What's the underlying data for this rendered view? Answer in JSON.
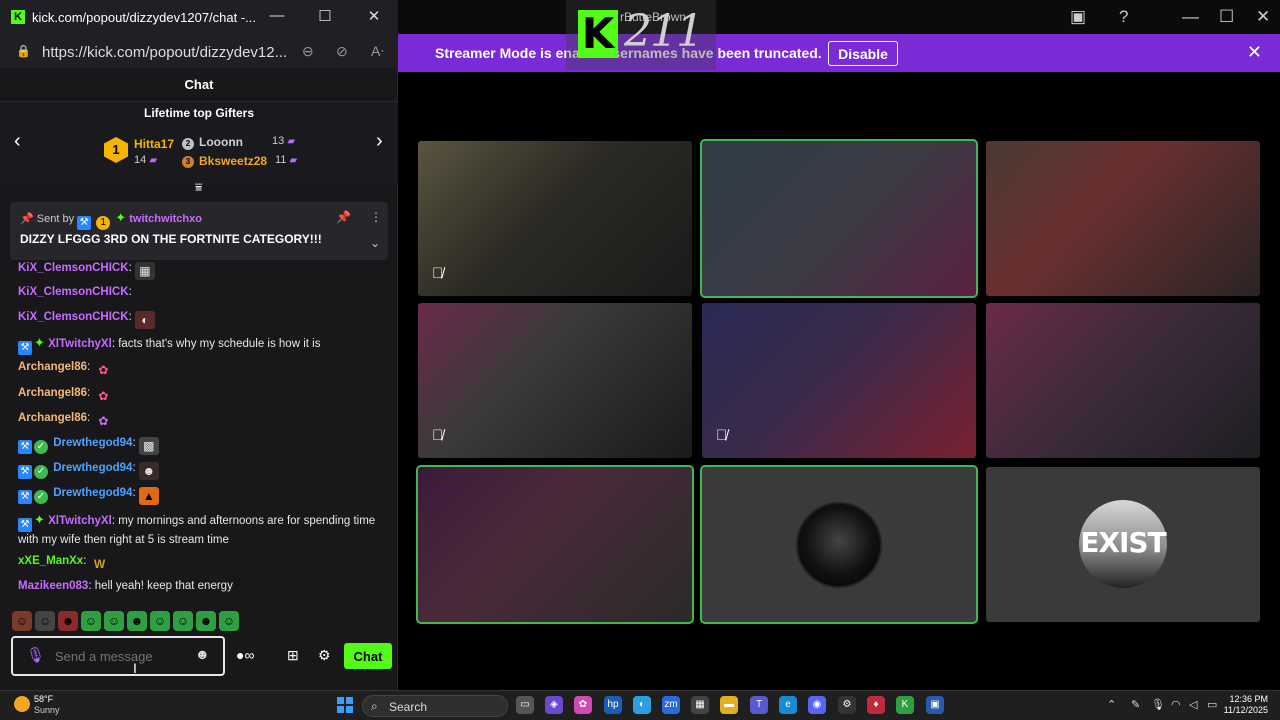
{
  "window": {
    "title": "kick.com/popout/dizzydev1207/chat -...",
    "url": "https://kick.com/popout/dizzydev12..."
  },
  "chat": {
    "header": "Chat",
    "gifters": {
      "title": "Lifetime top Gifters",
      "top": {
        "rank": "1",
        "name": "Hitta17",
        "count": "14"
      },
      "second": {
        "name": "Looonn",
        "count": "13"
      },
      "third": {
        "name": "Bksweetz28",
        "count": "11"
      }
    },
    "pinned": {
      "sent_by_label": "Sent by",
      "sent_by_user": "twitchwitchxo",
      "message": "DIZZY LFGGG 3RD ON THE FORTNITE CATEGORY!!!"
    },
    "messages": [
      {
        "user": "KiX_ClemsonCHICK",
        "text": ""
      },
      {
        "user": "KiX_ClemsonCHICK",
        "text": ""
      },
      {
        "user": "KiX_ClemsonCHICK",
        "text": ""
      },
      {
        "user": "XlTwitchyXl",
        "text": "facts that's why my schedule is how it is"
      },
      {
        "user": "Archangel86",
        "text": ""
      },
      {
        "user": "Archangel86",
        "text": ""
      },
      {
        "user": "Archangel86",
        "text": ""
      },
      {
        "user": "Drewthegod94",
        "text": ""
      },
      {
        "user": "Drewthegod94",
        "text": ""
      },
      {
        "user": "Drewthegod94",
        "text": ""
      },
      {
        "user": "XlTwitchyXl",
        "text": "my mornings and afternoons are for spending time with my wife then right at 5 is stream time"
      },
      {
        "user": "xXE_ManXx",
        "text": ""
      },
      {
        "user": "Mazikeen083",
        "text": "hell yeah! keep that energy"
      }
    ],
    "input_placeholder": "Send a message",
    "send_label": "Chat"
  },
  "streamer_banner": {
    "text": "Streamer Mode is enab... usernames have been truncated.",
    "button": "Disable"
  },
  "overlay": {
    "logo_letter": "K",
    "number": "211",
    "name_fragment": "rButteBrown"
  },
  "tiles": [
    {
      "name": "participant-1",
      "muted": true,
      "active": false
    },
    {
      "name": "participant-2",
      "muted": false,
      "active": true
    },
    {
      "name": "participant-3",
      "muted": false,
      "active": false
    },
    {
      "name": "participant-4",
      "muted": true,
      "active": false
    },
    {
      "name": "participant-5",
      "muted": true,
      "active": false
    },
    {
      "name": "participant-6",
      "muted": false,
      "active": false
    },
    {
      "name": "participant-7",
      "muted": false,
      "active": true
    },
    {
      "name": "participant-8",
      "muted": false,
      "active": true
    },
    {
      "name": "participant-9",
      "muted": false,
      "active": false,
      "avatar_text": "EXIST"
    }
  ],
  "taskbar": {
    "temp": "58°F",
    "condition": "Sunny",
    "search": "Search",
    "time": "12:36 PM",
    "date": "11/12/2025"
  },
  "colors": {
    "kick_green": "#53fc18",
    "banner_purple": "#7a2bd6",
    "active_tile": "#3fb950"
  }
}
